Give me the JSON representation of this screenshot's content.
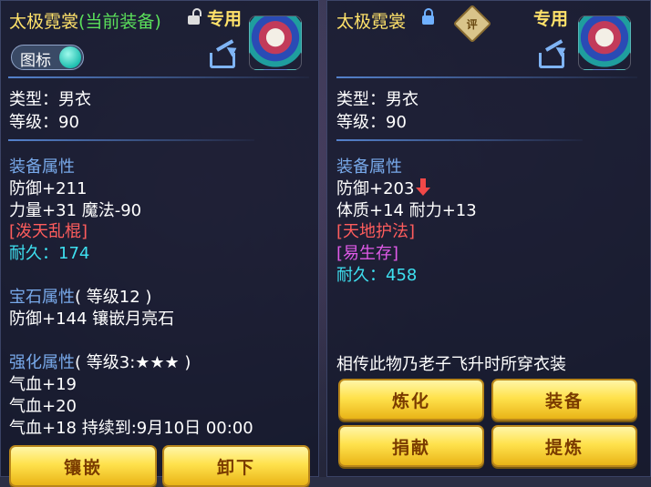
{
  "left": {
    "title_name": "太极霓裳",
    "title_status": "(当前装备)",
    "exclusive": "专用",
    "icon_toggle_label": "图标",
    "type": "类型：男衣",
    "level": "等级：90",
    "equip_header": "装备属性",
    "stats": [
      "防御+211",
      "力量+31 魔法-90"
    ],
    "special": "[泼天乱棍]",
    "durability": "耐久：174",
    "gem_header": "宝石属性",
    "gem_level": "( 等级12 )",
    "gem_stat": "防御+144 镶嵌月亮石",
    "enhance_header": "强化属性",
    "enhance_level": "( 等级3:★★★ )",
    "enhance_stats": [
      "气血+19",
      "气血+20",
      "气血+18   持续到:9月10日 00:00"
    ],
    "buttons": [
      "镶嵌",
      "卸下"
    ]
  },
  "right": {
    "title_name": "太极霓裳",
    "rate_icon_text": "评",
    "exclusive": "专用",
    "type": "类型：男衣",
    "level": "等级：90",
    "equip_header": "装备属性",
    "defense": "防御+203",
    "stats2": "体质+14 耐力+13",
    "special1": "[天地护法]",
    "special2": "[易生存]",
    "durability": "耐久：458",
    "description": "相传此物乃老子飞升时所穿衣装",
    "buttons": [
      "炼化",
      "装备",
      "捐献",
      "提炼"
    ]
  },
  "colors": {
    "title": "#ffe26a",
    "current": "#5be05b",
    "header": "#78a9ea",
    "special": "#ff5d5d",
    "durability": "#3ee0f0",
    "special2": "#e05ae8"
  },
  "icons": [
    "unlocked-icon",
    "locked-icon",
    "rate-icon",
    "share-icon",
    "avatar",
    "down-arrow-icon"
  ]
}
